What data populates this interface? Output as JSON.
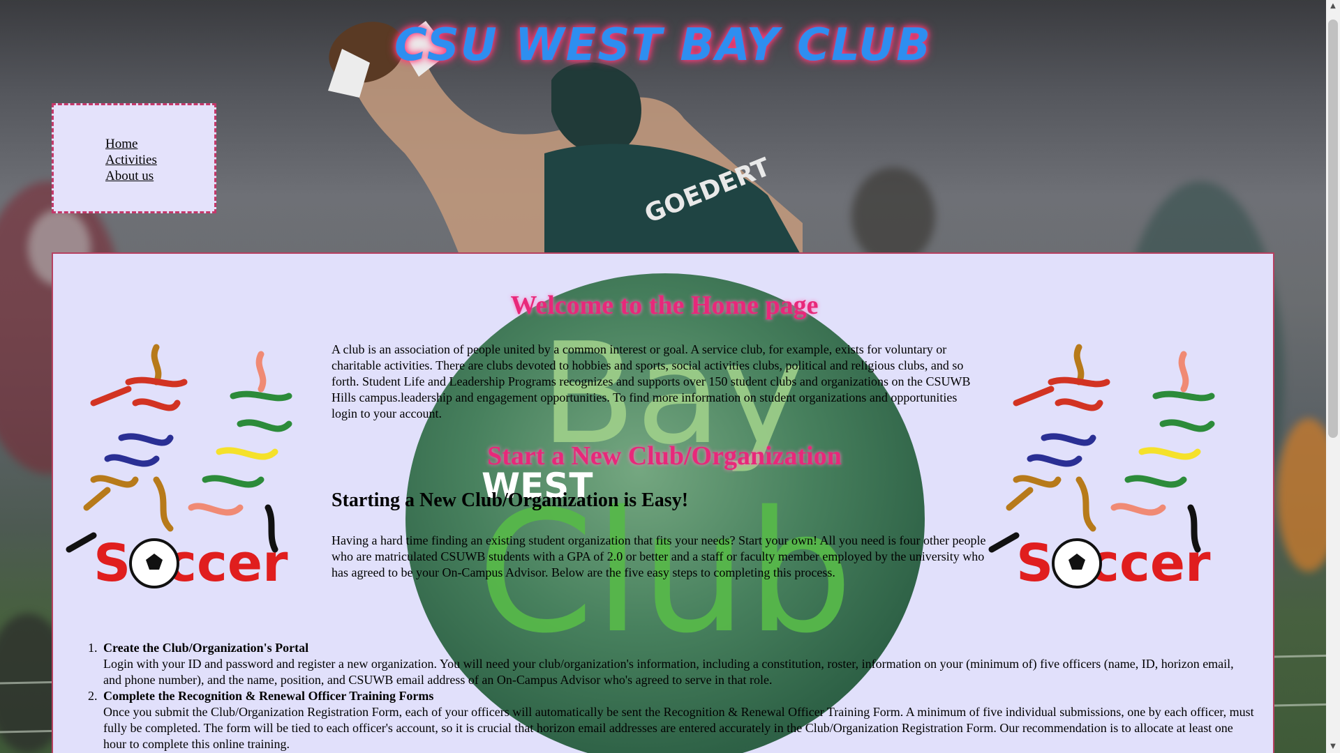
{
  "header": {
    "title": "CSU WEST BAY CLUB"
  },
  "nav": {
    "items": [
      {
        "label": "Home"
      },
      {
        "label": "Activities"
      },
      {
        "label": "About us"
      }
    ]
  },
  "main": {
    "welcome_heading": "Welcome to the Home page",
    "intro": "A club is an association of people united by a common interest or goal. A service club, for example, exists for voluntary or charitable activities. There are clubs devoted to hobbies and sports, social activities clubs, political and religious clubs, and so forth. Student Life and Leadership Programs recognizes and supports over 150 student clubs and organizations on the CSUWB Hills campus.leadership and engagement opportunities. To find more information on student organizations and opportunities login to your account.",
    "start_heading": "Start a New Club/Organization",
    "easy_heading": "Starting a New Club/Organization is Easy!",
    "easy_text": "Having a hard time finding an existing student organization that fits your needs? Start your own! All you need is four other people who are matriculated CSUWB students with a GPA of 2.0 or better and a staff or faculty member employed by the university who has agreed to be your On-Campus Advisor. Below are the five easy steps to completing this process.",
    "steps": [
      {
        "title": "Create the Club/Organization's Portal",
        "body": "Login with your ID and password and register a new organization. You will need your club/organization's information, including a constitution, roster, information on your (minimum of) five officers (name, ID, horizon email, and phone number), and the name, position, and CSUWB email address of an On-Campus Advisor who's agreed to serve in that role."
      },
      {
        "title": "Complete the Recognition & Renewal Officer Training Forms",
        "body": "Once you submit the Club/Organization Registration Form, each of your officers will automatically be sent the Recognition & Renewal Officer Training Form. A minimum of five individual submissions, one by each officer, must fully be completed. The form will be tied to each officer's account, so it is crucial that horizon email addresses are entered accurately in the Club/Organization Registration Form. Our recommendation is to allocate at least one hour to complete this online training."
      }
    ]
  },
  "logo": {
    "word_west": "WEST",
    "word_bay": "Bay",
    "word_club": "Club"
  },
  "soccer_art": {
    "word": "Soccer"
  },
  "player": {
    "name": "GOEDERT"
  },
  "colors": {
    "title_blue": "#2e8ef0",
    "title_glow": "#ff3b7a",
    "heading_pink": "#e8287a",
    "panel_bg": "#e1e0fb",
    "panel_border": "#b64060",
    "logo_green": "#2f7a4a"
  },
  "icons": {
    "scroll_up": "scroll-up-arrow-icon",
    "scroll_down": "scroll-down-arrow-icon"
  }
}
